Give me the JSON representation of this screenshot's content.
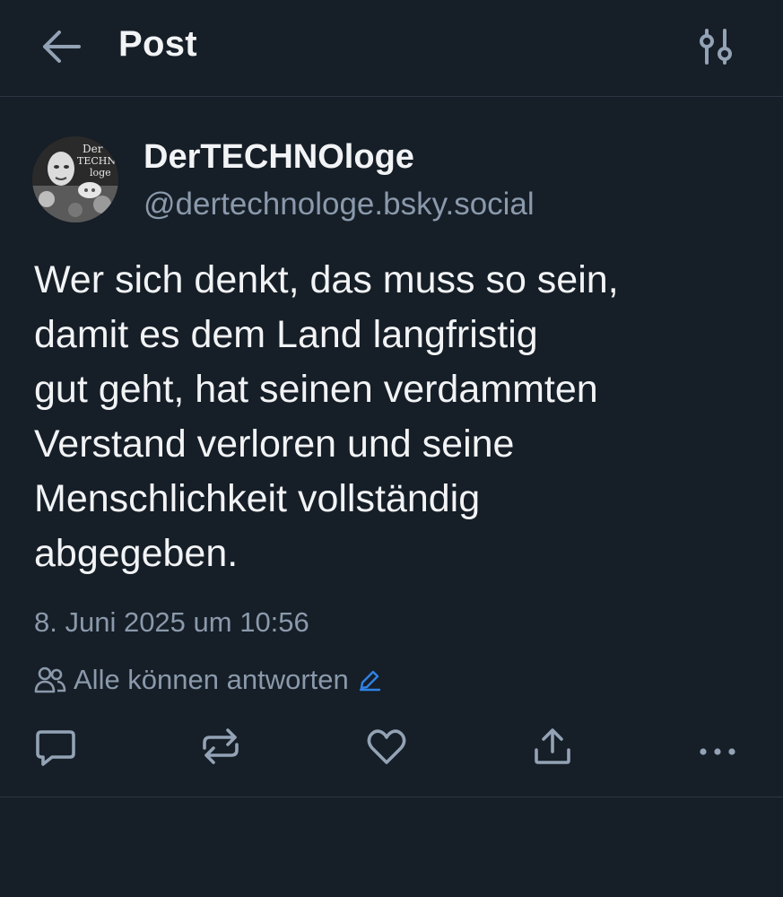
{
  "header": {
    "title": "Post",
    "back_icon": "arrow-left-icon",
    "settings_icon": "sliders-icon"
  },
  "post": {
    "author": {
      "display_name": "DerTECHNOloge",
      "handle": "@dertechnologe.bsky.social",
      "avatar_text": [
        "Der",
        "TECHN",
        "loge"
      ]
    },
    "text": "Wer sich denkt, das muss so sein,\ndamit es dem Land langfristig\ngut geht, hat seinen verdammten\nVerstand verloren und seine\nMenschlichkeit vollständig\nabgegeben.",
    "timestamp": "8. Juni 2025 um 10:56",
    "reply_settings": {
      "label": "Alle können antworten",
      "icon": "people-icon",
      "edit_icon": "pencil-icon"
    }
  },
  "actions": [
    "reply-icon",
    "repost-icon",
    "like-icon",
    "share-icon",
    "more-icon"
  ],
  "colors": {
    "background": "#161e27",
    "text": "#f1f3f5",
    "muted": "#8a99ab",
    "accent": "#2f82e6",
    "divider": "#2c3642"
  }
}
